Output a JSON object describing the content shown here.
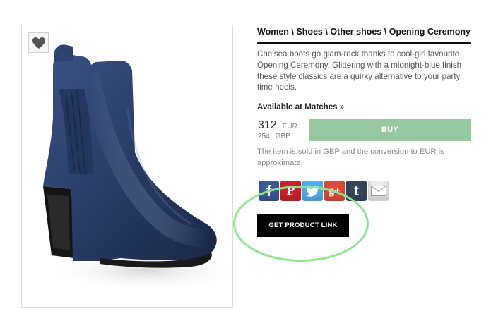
{
  "breadcrumb": {
    "items": [
      "Women",
      "Shoes",
      "Other shoes",
      "Opening Ceremony"
    ],
    "separator": "\\"
  },
  "product": {
    "description": "Chelsea boots go glam-rock thanks to cool-girl favourite Opening Ceremony. Glittering with a midnight-blue finish these style classics are a quirky alternative to your party time heels.",
    "available_at": "Available at Matches »",
    "price_primary": "312",
    "currency_primary": "EUR",
    "price_secondary": "254",
    "currency_secondary": "GBP",
    "buy_label": "BUY",
    "conversion_note": "The item is sold in GBP and the conversion to EUR is approximate.",
    "get_link_label": "GET PRODUCT LINK",
    "color_name": "midnight-blue"
  },
  "wishlist": {
    "icon": "heart-icon"
  },
  "share": [
    {
      "icon": "facebook-icon",
      "glyph": "f",
      "color": "#3b5998"
    },
    {
      "icon": "pinterest-icon",
      "glyph": "P",
      "color": "#c8232c"
    },
    {
      "icon": "twitter-icon",
      "glyph": "",
      "color": "#55acee"
    },
    {
      "icon": "google-plus-icon",
      "glyph": "g+",
      "color": "#dd4b39"
    },
    {
      "icon": "tumblr-icon",
      "glyph": "t",
      "color": "#35465c"
    },
    {
      "icon": "email-icon",
      "glyph": "",
      "color": "#e8e8e8"
    }
  ],
  "colors": {
    "buy_button": "#97c8a0",
    "highlight_ring": "#8fe58f",
    "boot": "#2c3f6b"
  }
}
